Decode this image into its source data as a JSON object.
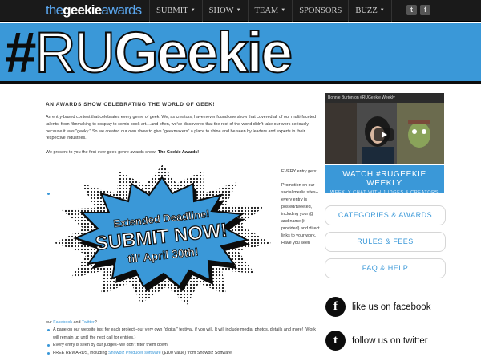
{
  "site": {
    "logo_prefix": "the",
    "logo_bold": "geekie",
    "logo_suffix": "awards"
  },
  "nav": {
    "items": [
      {
        "label": "SUBMIT",
        "has_dropdown": true
      },
      {
        "label": "SHOW",
        "has_dropdown": true
      },
      {
        "label": "TEAM",
        "has_dropdown": true
      },
      {
        "label": "SPONSORS",
        "has_dropdown": false
      },
      {
        "label": "BUZZ",
        "has_dropdown": true
      }
    ],
    "social": {
      "tumblr": "t",
      "facebook": "f"
    }
  },
  "banner": {
    "hash": "#",
    "ru": "RU",
    "geekie": "Geekie"
  },
  "content": {
    "tagline": "AN AWARDS SHOW CELEBRATING THE WORLD OF GEEK!",
    "intro": "An entry-based contest that celebrates every genre of geek. We, as creators, have never found one show that covered all of our multi-faceted talents, from filmmaking to cosplay to comic book art....and often, we've discovered that the rest of the world didn't take our work seriously because it was \"geeky.\" So we created our own show to give \"geekmakers\" a place to shine and be seen by leaders and experts in their respective industries.",
    "present_prefix": "We present to you the first-ever geek-genre awards show: ",
    "present_bold": "The Geekie Awards!",
    "promo": {
      "line1": "Extended Deadline!",
      "line2": "SUBMIT NOW!",
      "line3": "til' April 30th!"
    },
    "side_every": "EVERY entry gets:",
    "side_promo": "Promotion on our social media sites--every entry is posted/tweeted, including your @ and name (if provided) and direct links to your work. Have you seen",
    "bottom_our": "our ",
    "bottom_facebook": "Facebook",
    "bottom_and": " and ",
    "bottom_twitter": "Twitter",
    "bottom_q": "?",
    "bullets": [
      "A page on our website just for each project--our very own \"digital\" festival, if you will. It will include media, photos, details and more! (Work will remain up until the next call for entries.)",
      "Every entry is seen by our judges--we don't filter them down."
    ],
    "free_prefix": "FREE REWARDS, including ",
    "free_link": "Showbiz Producer software",
    "free_suffix": " ($100 value) from Showbiz Software,"
  },
  "sidebar": {
    "video_title": "Bonnie Burton on #RUGeekie Weekly",
    "watch_title": "WATCH #RUGEEKIE WEEKLY",
    "watch_sub": "WEEKLY CHAT WITH JUDGES & CREATORS",
    "buttons": [
      "CATEGORIES & AWARDS",
      "RULES & FEES",
      "FAQ & HELP"
    ],
    "facebook_icon": "f",
    "facebook_label": "like us on facebook",
    "twitter_icon": "t",
    "twitter_label": "follow us on twitter"
  },
  "colors": {
    "accent": "#3a98d8",
    "nav_bg": "#1a1a1a",
    "ink": "#0c0c0c"
  }
}
